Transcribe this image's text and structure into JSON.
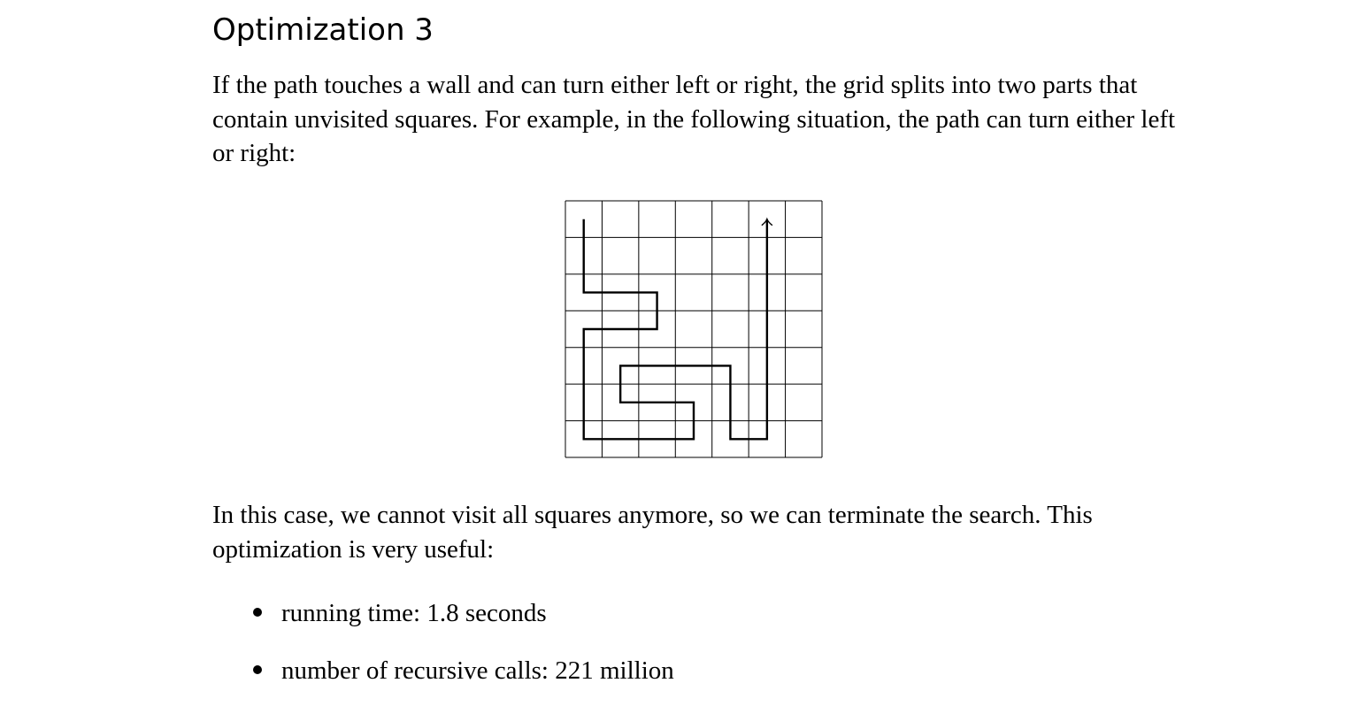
{
  "heading": "Optimization 3",
  "paragraph_1": "If the path touches a wall and can turn either left or right, the grid splits into two parts that contain unvisited squares. For example, in the following situation, the path can turn either left or right:",
  "paragraph_2": "In this case, we cannot visit all squares anymore, so we can terminate the search. This optimization is very useful:",
  "bullets": [
    "running time: 1.8 seconds",
    "number of recursive calls: 221 million"
  ],
  "figure": {
    "grid_size": 7,
    "path_cells": [
      [
        0,
        0
      ],
      [
        0,
        1
      ],
      [
        0,
        2
      ],
      [
        1,
        2
      ],
      [
        2,
        2
      ],
      [
        2,
        3
      ],
      [
        1,
        3
      ],
      [
        0,
        3
      ],
      [
        0,
        4
      ],
      [
        0,
        5
      ],
      [
        0,
        6
      ],
      [
        1,
        6
      ],
      [
        2,
        6
      ],
      [
        3,
        6
      ],
      [
        3,
        5
      ],
      [
        2,
        5
      ],
      [
        1,
        5
      ],
      [
        1,
        4
      ],
      [
        2,
        4
      ],
      [
        3,
        4
      ],
      [
        4,
        4
      ],
      [
        4,
        5
      ],
      [
        4,
        6
      ],
      [
        5,
        6
      ],
      [
        5,
        5
      ],
      [
        5,
        4
      ],
      [
        5,
        3
      ],
      [
        5,
        2
      ],
      [
        5,
        1
      ],
      [
        5,
        0
      ]
    ],
    "path_end_marker": "arrow-up-icon"
  }
}
